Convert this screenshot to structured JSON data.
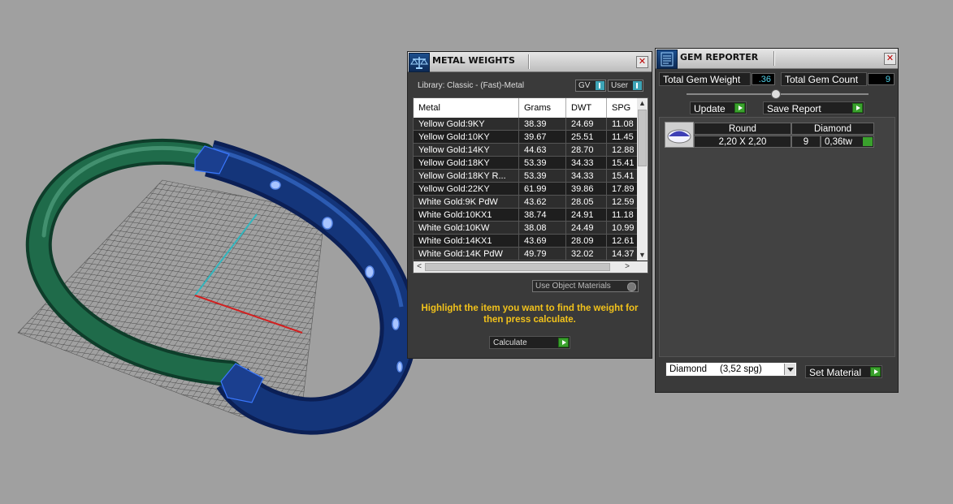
{
  "metal_weights": {
    "title": "METAL WEIGHTS",
    "library_label": "Library: Classic - (Fast)-Metal",
    "gv_label": "GV",
    "user_label": "User",
    "columns": [
      "Metal",
      "Grams",
      "DWT",
      "SPG"
    ],
    "rows": [
      [
        "Yellow Gold:9KY",
        "38.39",
        "24.69",
        "11.08"
      ],
      [
        "Yellow Gold:10KY",
        "39.67",
        "25.51",
        "11.45"
      ],
      [
        "Yellow Gold:14KY",
        "44.63",
        "28.70",
        "12.88"
      ],
      [
        "Yellow Gold:18KY",
        "53.39",
        "34.33",
        "15.41"
      ],
      [
        "Yellow Gold:18KY R...",
        "53.39",
        "34.33",
        "15.41"
      ],
      [
        "Yellow Gold:22KY",
        "61.99",
        "39.86",
        "17.89"
      ],
      [
        "White Gold:9K PdW",
        "43.62",
        "28.05",
        "12.59"
      ],
      [
        "White Gold:10KX1",
        "38.74",
        "24.91",
        "11.18"
      ],
      [
        "White Gold:10KW",
        "38.08",
        "24.49",
        "10.99"
      ],
      [
        "White Gold:14KX1",
        "43.69",
        "28.09",
        "12.61"
      ],
      [
        "White Gold:14K PdW",
        "49.79",
        "32.02",
        "14.37"
      ]
    ],
    "use_object_materials_label": "Use Object Materials",
    "hint": "Highlight the item you want to find the weight for then press calculate.",
    "calculate_label": "Calculate"
  },
  "gem_reporter": {
    "title": "GEM REPORTER",
    "total_weight_label": "Total Gem Weight",
    "total_weight_value": ".36",
    "total_count_label": "Total Gem Count",
    "total_count_value": "9",
    "update_label": "Update",
    "save_report_label": "Save Report",
    "gem": {
      "shape": "Round",
      "material": "Diamond",
      "size": "2,20 X 2,20",
      "count": "9",
      "weight": "0,36tw"
    },
    "material_select": "Diamond     (3,52 spg)",
    "set_material_label": "Set Material"
  },
  "colors": {
    "accent_yellow": "#f2c21b",
    "value_cyan": "#4fd0e8",
    "go_green": "#3aa12d",
    "band_green": "#1f6b4a",
    "band_blue": "#14357a"
  }
}
